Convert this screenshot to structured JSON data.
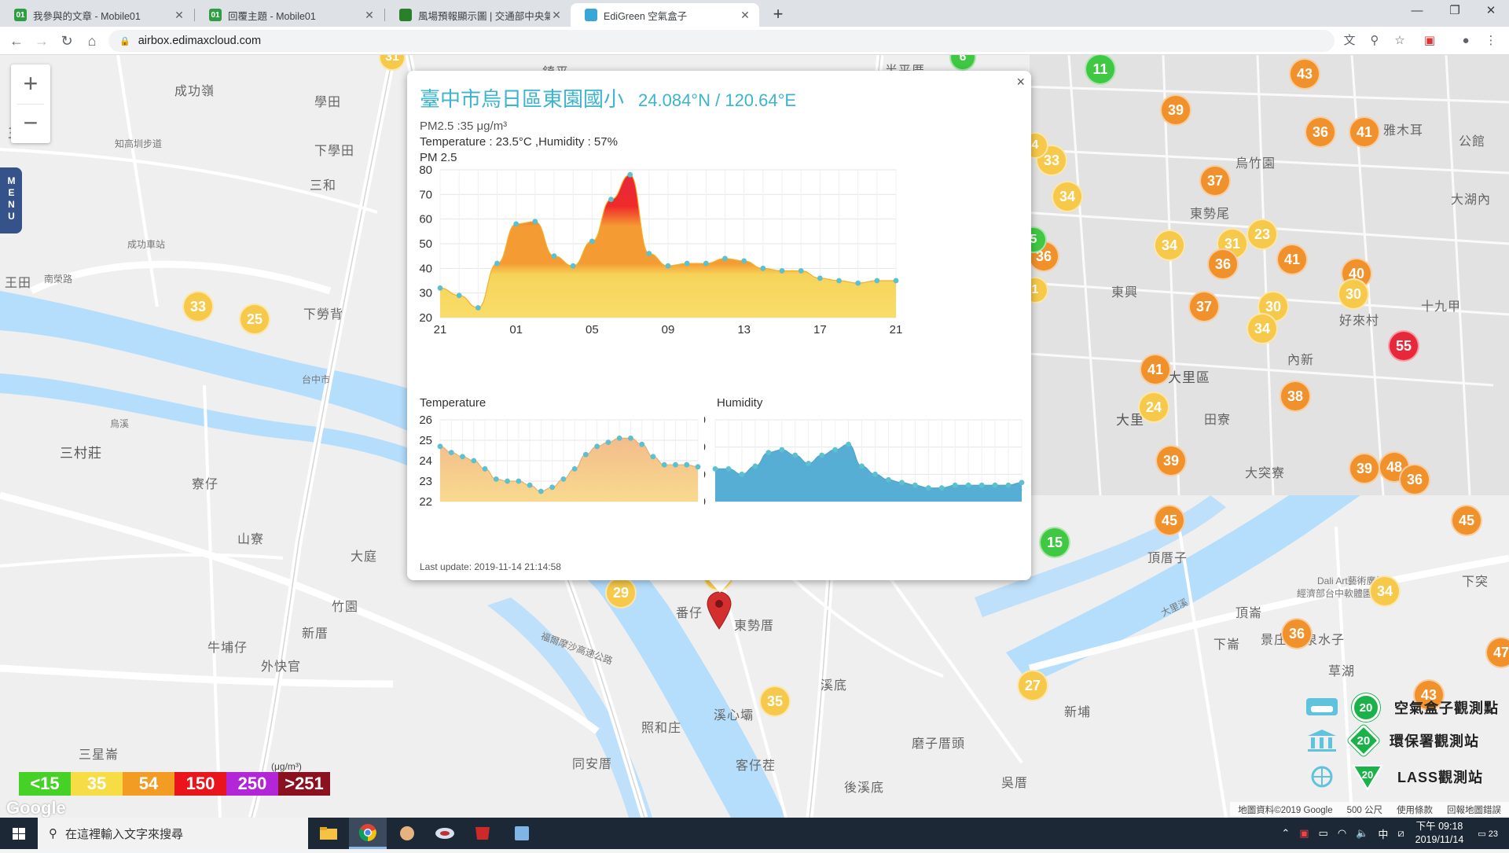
{
  "browser": {
    "tabs": [
      {
        "title": "我參與的文章 - Mobile01",
        "icon_color": "#2e9e42",
        "active": false
      },
      {
        "title": "回覆主題 - Mobile01",
        "icon_color": "#2e9e42",
        "active": false
      },
      {
        "title": "風場預報顯示圖 | 交通部中央氣象局",
        "icon_color": "#2a7f2a",
        "active": false
      },
      {
        "title": "EdiGreen 空氣盒子",
        "icon_color": "#3aa6d8",
        "active": true
      }
    ],
    "url": "airbox.edimaxcloud.com"
  },
  "map": {
    "zoom_in": "+",
    "zoom_out": "−",
    "menu_label": "MENU",
    "places": [
      {
        "text": "成功嶺"
      },
      {
        "text": "學田"
      },
      {
        "text": "王田"
      },
      {
        "text": "知高圳步道"
      },
      {
        "text": "下學田"
      },
      {
        "text": "三和"
      },
      {
        "text": "成功車站"
      },
      {
        "text": "王田"
      },
      {
        "text": "南榮路"
      },
      {
        "text": "下勞背"
      },
      {
        "text": "台中市"
      },
      {
        "text": "烏溪"
      },
      {
        "text": "三村莊"
      },
      {
        "text": "寮仔"
      },
      {
        "text": "山寮"
      },
      {
        "text": "大庭"
      },
      {
        "text": "竹園"
      },
      {
        "text": "新厝"
      },
      {
        "text": "牛埔仔"
      },
      {
        "text": "外快官"
      },
      {
        "text": "三星崙"
      },
      {
        "text": "番仔"
      },
      {
        "text": "東勢厝"
      },
      {
        "text": "溪底"
      },
      {
        "text": "溪心壩"
      },
      {
        "text": "照和庄"
      },
      {
        "text": "同安厝"
      },
      {
        "text": "客仔茬"
      },
      {
        "text": "後溪底"
      },
      {
        "text": "磨子厝頭"
      },
      {
        "text": "新埔"
      },
      {
        "text": "頂厝子"
      },
      {
        "text": "大突寮"
      },
      {
        "text": "大里區"
      },
      {
        "text": "大里"
      },
      {
        "text": "田寮"
      },
      {
        "text": "東興"
      },
      {
        "text": "內新"
      },
      {
        "text": "東勢尾"
      },
      {
        "text": "烏竹園"
      },
      {
        "text": "好來村"
      },
      {
        "text": "十九甲"
      },
      {
        "text": "大湖內"
      },
      {
        "text": "雅木耳"
      },
      {
        "text": "公館"
      },
      {
        "text": "頂崙"
      },
      {
        "text": "下崙"
      },
      {
        "text": "景庄"
      },
      {
        "text": "泉水子"
      },
      {
        "text": "草湖"
      },
      {
        "text": "Dali Art藝術廣場"
      },
      {
        "text": "經濟部台中軟體園區"
      },
      {
        "text": "鎮平"
      },
      {
        "text": "半平厝"
      },
      {
        "text": "福爾摩沙高速公路"
      },
      {
        "text": "大里溪"
      },
      {
        "text": "吳厝"
      },
      {
        "text": "下突"
      }
    ],
    "markers": [
      {
        "value": "31",
        "color": "#f6c94a"
      },
      {
        "value": "6",
        "color": "#40c844"
      },
      {
        "value": "11",
        "color": "#40c844"
      },
      {
        "value": "43",
        "color": "#f0912c"
      },
      {
        "value": "39",
        "color": "#f0912c"
      },
      {
        "value": "36",
        "color": "#f0912c"
      },
      {
        "value": "41",
        "color": "#f0912c"
      },
      {
        "value": "33",
        "color": "#f6c94a"
      },
      {
        "value": "34",
        "color": "#f6c94a"
      },
      {
        "value": "37",
        "color": "#f0912c"
      },
      {
        "value": "34",
        "color": "#f6c94a"
      },
      {
        "value": "31",
        "color": "#f6c94a"
      },
      {
        "value": "23",
        "color": "#f6c94a"
      },
      {
        "value": "36",
        "color": "#f0912c"
      },
      {
        "value": "36",
        "color": "#f0912c"
      },
      {
        "value": "41",
        "color": "#f0912c"
      },
      {
        "value": "40",
        "color": "#f0912c"
      },
      {
        "value": "30",
        "color": "#f6c94a"
      },
      {
        "value": "37",
        "color": "#f0912c"
      },
      {
        "value": "30",
        "color": "#f6c94a"
      },
      {
        "value": "34",
        "color": "#f6c94a"
      },
      {
        "value": "55",
        "color": "#e8283a"
      },
      {
        "value": "41",
        "color": "#f0912c"
      },
      {
        "value": "24",
        "color": "#f6c94a"
      },
      {
        "value": "38",
        "color": "#f0912c"
      },
      {
        "value": "39",
        "color": "#f0912c"
      },
      {
        "value": "39",
        "color": "#f0912c"
      },
      {
        "value": "48",
        "color": "#f0912c"
      },
      {
        "value": "36",
        "color": "#f0912c"
      },
      {
        "value": "45",
        "color": "#f0912c"
      },
      {
        "value": "45",
        "color": "#f0912c"
      },
      {
        "value": "15",
        "color": "#40c844"
      },
      {
        "value": "34",
        "color": "#f6c94a"
      },
      {
        "value": "36",
        "color": "#f0912c"
      },
      {
        "value": "47",
        "color": "#f0912c"
      },
      {
        "value": "43",
        "color": "#f0912c"
      },
      {
        "value": "27",
        "color": "#f6c94a"
      },
      {
        "value": "35",
        "color": "#f6c94a"
      },
      {
        "value": "29",
        "color": "#f6c94a"
      },
      {
        "value": "35",
        "color": "#f6c94a"
      },
      {
        "value": "33",
        "color": "#f6c94a"
      },
      {
        "value": "25",
        "color": "#f6c94a"
      },
      {
        "value": "5",
        "color": "#40c844"
      },
      {
        "value": "4",
        "color": "#f6c94a"
      },
      {
        "value": "1",
        "color": "#f6c94a"
      }
    ],
    "legend": {
      "unit": "(μg/m³)",
      "items": [
        {
          "label": "<15",
          "color": "#45d126"
        },
        {
          "label": "35",
          "color": "#f6dc45"
        },
        {
          "label": "54",
          "color": "#f39c23"
        },
        {
          "label": "150",
          "color": "#e9141c"
        },
        {
          "label": "250",
          "color": "#b326d8"
        },
        {
          "label": ">251",
          "color": "#8c1120"
        }
      ]
    },
    "key": [
      {
        "badge": "20",
        "label": "空氣盒子觀測點"
      },
      {
        "badge": "20",
        "label": "環保署觀測站"
      },
      {
        "badge": "20",
        "label": "LASS觀測站"
      }
    ],
    "google": "Google",
    "footer": [
      "地圖資料©2019 Google",
      "500 公尺",
      "使用條款",
      "回報地圖錯誤"
    ]
  },
  "popup": {
    "title": "臺中市烏日區東園國小",
    "coords": "24.084°N / 120.64°E",
    "pm_line": "PM2.5 :35 μg/m³",
    "temp_hum_line": "Temperature : 23.5°C ,Humidity : 57%",
    "pm_chart_label": "PM 2.5",
    "temp_chart_label": "Temperature",
    "hum_chart_label": "Humidity",
    "last_update": "Last update: 2019-11-14 21:14:58",
    "close": "×"
  },
  "chart_data": [
    {
      "type": "area",
      "title": "PM 2.5",
      "x_ticks": [
        "21",
        "01",
        "05",
        "09",
        "13",
        "17",
        "21"
      ],
      "ylim": [
        20,
        80
      ],
      "y_ticks": [
        20,
        30,
        40,
        50,
        60,
        70,
        80
      ],
      "values": [
        32,
        29,
        24,
        42,
        58,
        59,
        45,
        41,
        51,
        68,
        78,
        46,
        41,
        42,
        42,
        44,
        43,
        40,
        39,
        39,
        36,
        35,
        34,
        35,
        35
      ]
    },
    {
      "type": "area",
      "title": "Temperature",
      "ylim": [
        22,
        26
      ],
      "y_ticks": [
        22,
        23,
        24,
        25,
        26
      ],
      "values": [
        24.7,
        24.4,
        24.2,
        24.0,
        23.6,
        23.1,
        23.0,
        23.0,
        22.8,
        22.5,
        22.7,
        23.1,
        23.6,
        24.3,
        24.7,
        24.9,
        25.1,
        25.1,
        24.8,
        24.2,
        23.8,
        23.8,
        23.8,
        23.7
      ]
    },
    {
      "type": "area",
      "title": "Humidity",
      "ylim": [
        50,
        80
      ],
      "y_ticks": [
        50,
        60,
        70,
        80
      ],
      "values": [
        62,
        62,
        60,
        63,
        68,
        69,
        67,
        64,
        67,
        69,
        71,
        63,
        60,
        58,
        57,
        56,
        55,
        55,
        56,
        56,
        56,
        56,
        56,
        57
      ]
    }
  ],
  "taskbar": {
    "search_placeholder": "在這裡輸入文字來搜尋",
    "time": "下午 09:18",
    "date": "2019/11/14",
    "ime": "中",
    "notif": "23"
  }
}
